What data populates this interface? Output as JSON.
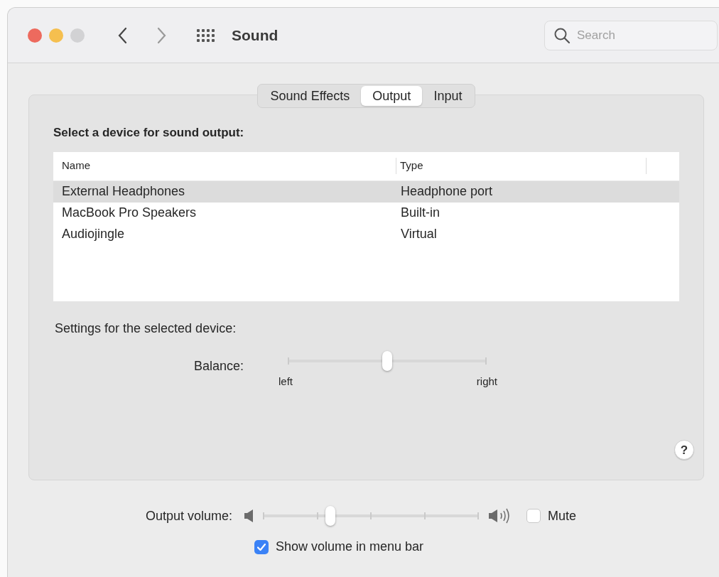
{
  "window": {
    "title": "Sound"
  },
  "search": {
    "placeholder": "Search"
  },
  "tabs": [
    {
      "label": "Sound Effects",
      "selected": false
    },
    {
      "label": "Output",
      "selected": true
    },
    {
      "label": "Input",
      "selected": false
    }
  ],
  "device_heading": "Select a device for sound output:",
  "table": {
    "columns": [
      "Name",
      "Type"
    ],
    "rows": [
      {
        "cells": [
          "External Headphones",
          "Headphone port"
        ],
        "selected": true
      },
      {
        "cells": [
          "MacBook Pro Speakers",
          "Built-in"
        ],
        "selected": false
      },
      {
        "cells": [
          "Audiojingle",
          "Virtual"
        ],
        "selected": false
      }
    ]
  },
  "settings_heading": "Settings for the selected device:",
  "balance": {
    "label": "Balance:",
    "level": 0.5,
    "left_label": "left",
    "right_label": "right"
  },
  "help": "?",
  "output_volume": {
    "label": "Output volume:",
    "level": 0.31
  },
  "mute": {
    "label": "Mute",
    "checked": false
  },
  "show_volume": {
    "label": "Show volume in menu bar",
    "checked": true
  }
}
